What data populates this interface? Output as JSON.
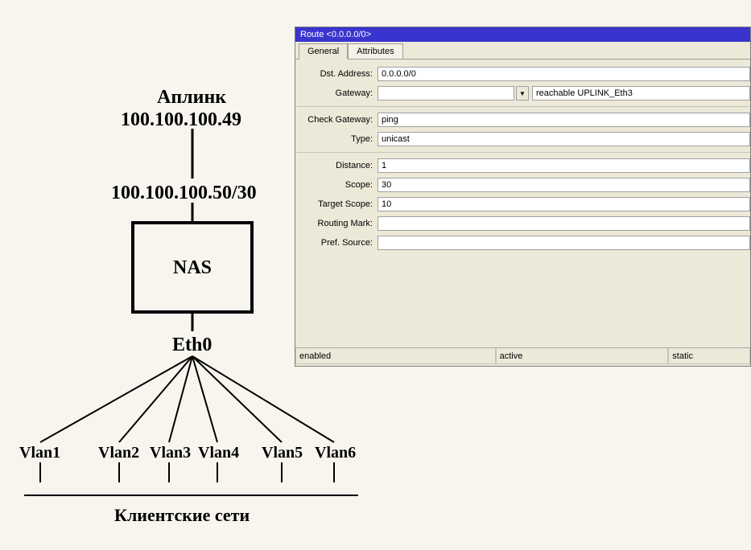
{
  "diagram": {
    "uplink_label": "Аплинк",
    "uplink_ip": "100.100.100.49",
    "nas_ip": "100.100.100.50/30",
    "nas_label": "NAS",
    "nas_if": "Eth0",
    "vlans": [
      "Vlan1",
      "Vlan2",
      "Vlan3",
      "Vlan4",
      "Vlan5",
      "Vlan6"
    ],
    "clients_label": "Клиентские сети"
  },
  "dialog": {
    "title": "Route <0.0.0.0/0>",
    "tabs": {
      "general": "General",
      "attributes": "Attributes"
    },
    "fields": {
      "dst_address": {
        "label": "Dst. Address:",
        "value": "0.0.0.0/0"
      },
      "gateway": {
        "label": "Gateway:",
        "value": "",
        "status": "reachable UPLINK_Eth3"
      },
      "check_gateway": {
        "label": "Check Gateway:",
        "value": "ping"
      },
      "type": {
        "label": "Type:",
        "value": "unicast"
      },
      "distance": {
        "label": "Distance:",
        "value": "1"
      },
      "scope": {
        "label": "Scope:",
        "value": "30"
      },
      "target_scope": {
        "label": "Target Scope:",
        "value": "10"
      },
      "routing_mark": {
        "label": "Routing Mark:",
        "value": ""
      },
      "pref_source": {
        "label": "Pref. Source:",
        "value": ""
      }
    },
    "statusbar": {
      "c1": "enabled",
      "c2": "active",
      "c3": "static"
    }
  }
}
